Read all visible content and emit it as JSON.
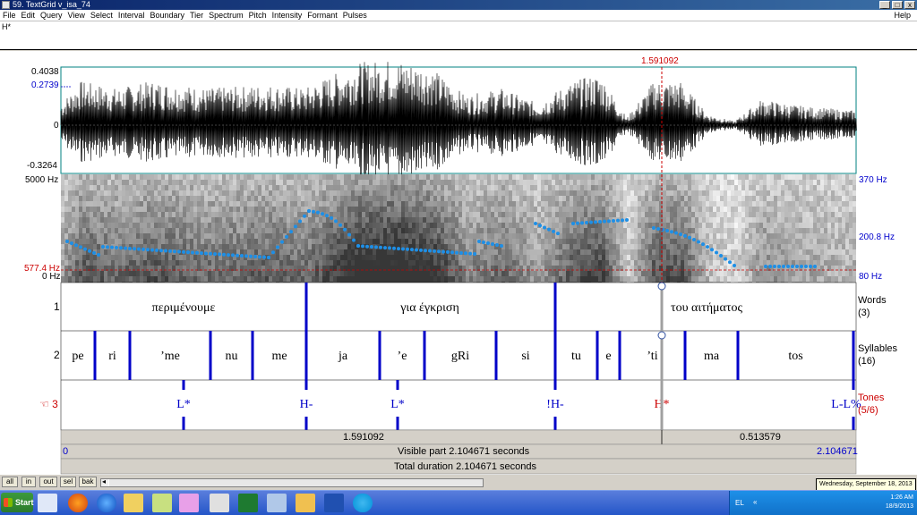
{
  "window": {
    "title": "59. TextGrid v_isa_74"
  },
  "menu": [
    "File",
    "Edit",
    "Query",
    "View",
    "Select",
    "Interval",
    "Boundary",
    "Tier",
    "Spectrum",
    "Pitch",
    "Intensity",
    "Formant",
    "Pulses"
  ],
  "menu_help": "Help",
  "text_field": {
    "value": "H*"
  },
  "cursor_time": "1.591092",
  "waveform": {
    "ymax": "0.4038",
    "yref": "0.2739",
    "yzero": "0",
    "ymin": "-0.3264"
  },
  "spectrogram": {
    "fmax": "5000 Hz",
    "fcursor": "577.4 Hz",
    "fmin": "0 Hz",
    "pitch_max": "370 Hz",
    "pitch_mid": "200.8 Hz",
    "pitch_min": "80 Hz"
  },
  "tiers": [
    {
      "number": "1",
      "name": "Words",
      "count": "(3)",
      "labels": [
        "περιμένουμε",
        "για έγκριση",
        "του αιτήματος"
      ]
    },
    {
      "number": "2",
      "name": "Syllables",
      "count": "(16)",
      "labels": [
        "pe",
        "ri",
        "’me",
        "nu",
        "me",
        "ja",
        "’e",
        "gRi",
        "si",
        "tu",
        "e",
        "’ti",
        "ma",
        "tos"
      ]
    },
    {
      "number": "3",
      "name": "Tones",
      "count": "(5/6)",
      "labels": [
        "L*",
        "H-",
        "L*",
        "!H-",
        "H*",
        "L-L%"
      ]
    }
  ],
  "time_bar": {
    "left_segment": "1.591092",
    "right_segment": "0.513579",
    "start": "0",
    "visible": "Visible part 2.104671 seconds",
    "end": "2.104671",
    "total": "Total duration 2.104671 seconds"
  },
  "zoom_buttons": [
    "all",
    "in",
    "out",
    "sel",
    "bak"
  ],
  "tooltip": "Wednesday, September 18, 2013",
  "taskbar": {
    "start": "Start",
    "lang": "EL",
    "time": "1:26 AM",
    "date": "18/9/2013"
  },
  "colors": {
    "pitch": "#1e8fe6",
    "cursor": "#cc0000",
    "boundary": "#0000c8",
    "tone_selected": "#e03020"
  },
  "icons": [
    "start-icon",
    "media-player-icon",
    "firefox-icon",
    "ie-icon",
    "explorer-icon",
    "folder-icon",
    "paint-icon",
    "excel-chart-icon",
    "excel-icon",
    "window-icon",
    "notes-icon",
    "word-icon",
    "skype-icon"
  ]
}
